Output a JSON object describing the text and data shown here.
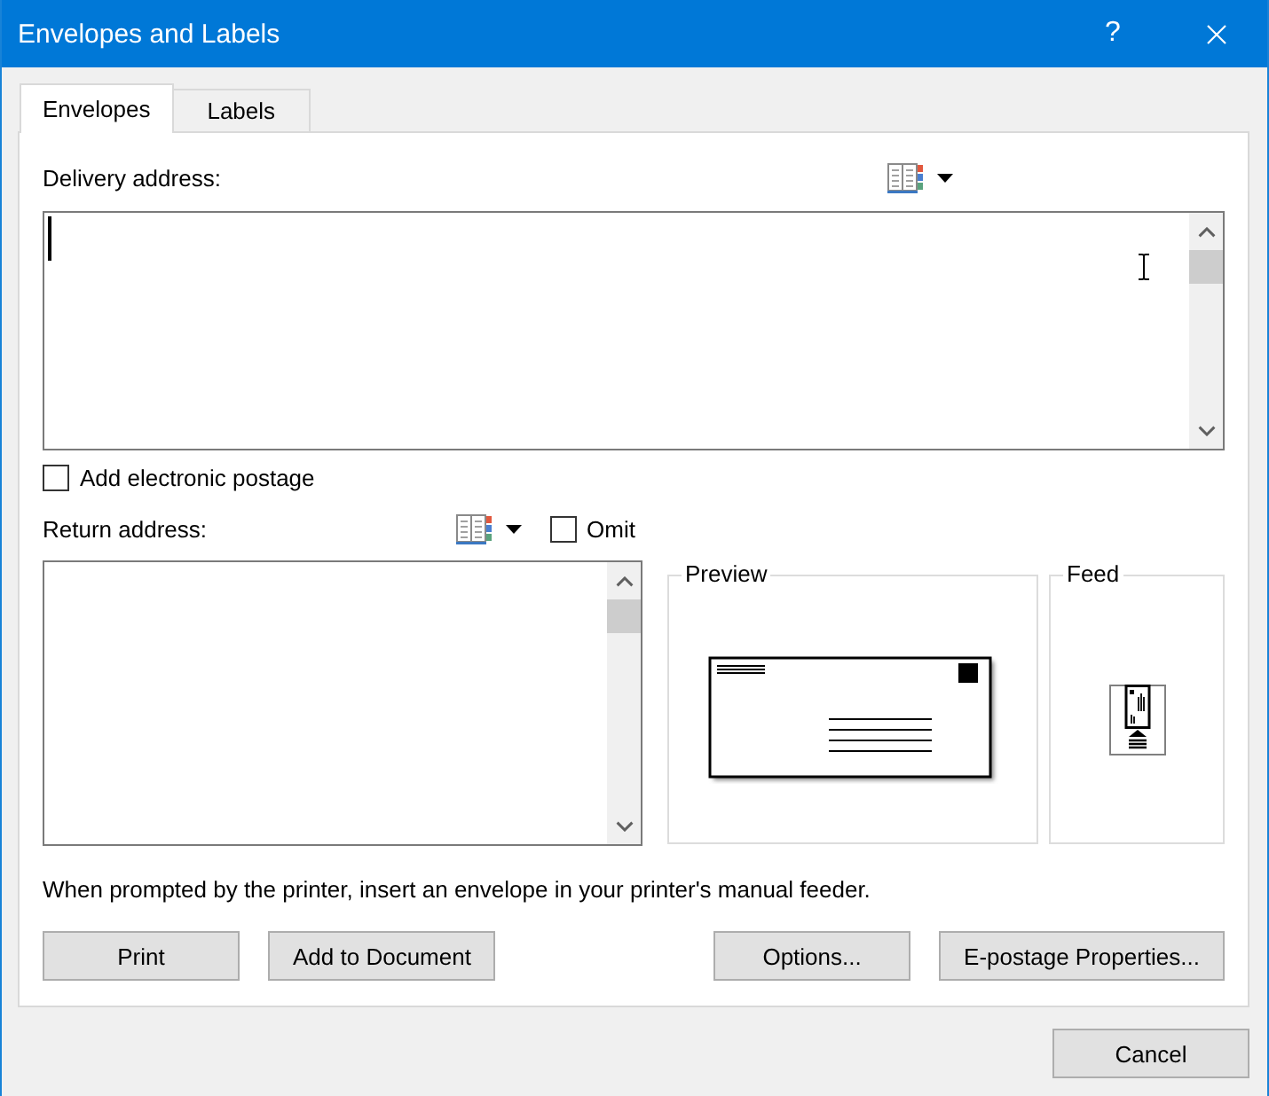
{
  "window": {
    "title": "Envelopes and Labels",
    "help_button": "?"
  },
  "tabs": [
    {
      "label": "Envelopes",
      "selected": true
    },
    {
      "label": "Labels",
      "selected": false
    }
  ],
  "delivery_address": {
    "label": "Delivery address:",
    "focused": true
  },
  "electronic_postage": {
    "label": "Add electronic postage",
    "checked": false
  },
  "return_address": {
    "label": "Return address:"
  },
  "omit": {
    "label": "Omit",
    "checked": false
  },
  "preview": {
    "title": "Preview"
  },
  "feed": {
    "title": "Feed"
  },
  "instruction": "When prompted by the printer, insert an envelope in your printer's manual feeder.",
  "left_buttons": [
    {
      "label": "Print"
    },
    {
      "label": "Add to Document"
    }
  ],
  "right_buttons": [
    {
      "label": "Options..."
    },
    {
      "label": "E-postage Properties..."
    }
  ],
  "dialog_buttons": [
    {
      "label": "Cancel"
    }
  ]
}
